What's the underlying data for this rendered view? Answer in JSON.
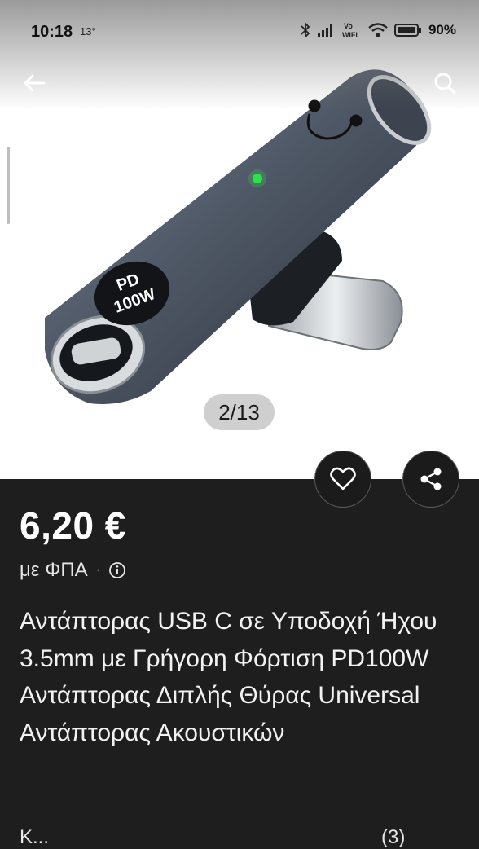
{
  "status_bar": {
    "time": "10:18",
    "temperature": "13°",
    "battery": "90%",
    "network_label": "Vo WiFi"
  },
  "image_viewer": {
    "counter": "2/13",
    "product_badge": {
      "line1": "PD",
      "line2": "100W"
    }
  },
  "icons": {
    "back": "arrow-left-icon",
    "search": "search-icon",
    "favorite": "heart-icon",
    "share": "share-icon",
    "info": "info-icon"
  },
  "product": {
    "price": "6,20 €",
    "vat_label": "με ΦΠΑ",
    "title": "Αντάπτορας USB C σε Υποδοχή Ήχου 3.5mm με Γρήγορη Φόρτιση PD100W Αντάπτορας Διπλής Θύρας Universal Αντάπτορας Ακουστικών"
  },
  "partial_row": {
    "left": "Κ...",
    "right": "(3)"
  },
  "colors": {
    "background_dark": "#1e1e1e",
    "led": "#2ee04a"
  }
}
